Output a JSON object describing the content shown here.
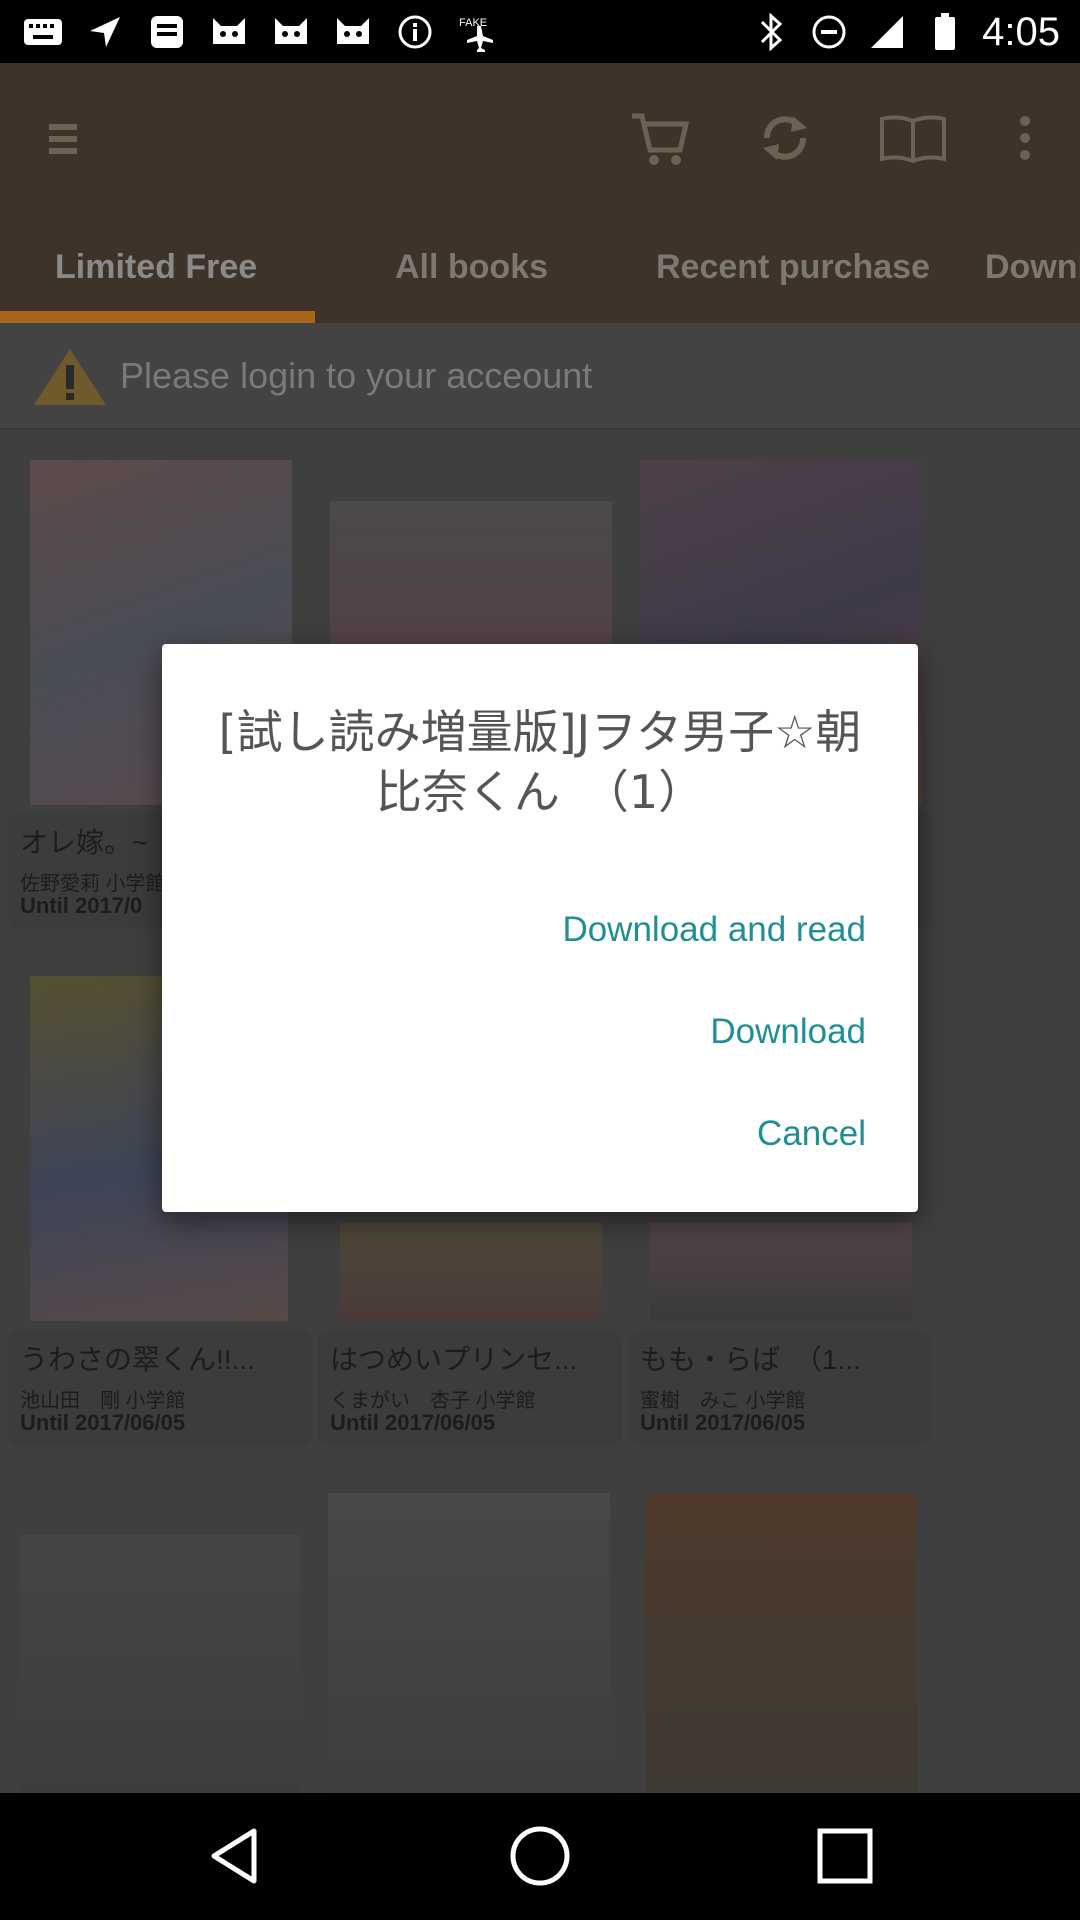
{
  "status_bar": {
    "time": "4:05",
    "icons": [
      "keyboard-icon",
      "navigation-icon",
      "app-icon",
      "cat-icon",
      "cat-icon",
      "cat-icon",
      "info-icon",
      "airplane-mode-icon",
      "bluetooth-icon",
      "silent-icon",
      "signal-icon",
      "battery-icon"
    ]
  },
  "app_bar": {
    "icons": [
      "menu-icon",
      "cart-icon",
      "refresh-icon",
      "book-icon",
      "more-icon"
    ]
  },
  "tabs": [
    "Limited Free",
    "All books",
    "Recent purchase",
    "Downl"
  ],
  "active_tab": "Limited Free",
  "login_banner": {
    "text": "Please login to your acceount"
  },
  "books": [
    {
      "title": "オレ嫁。~",
      "author": "佐野愛莉 小学館",
      "until": "Until 2017/0"
    },
    {
      "title": "",
      "author": "",
      "until": ""
    },
    {
      "title": "",
      "author": "",
      "until": ""
    },
    {
      "title": "うわさの翠くん!!...",
      "author": "池山田　剛 小学館",
      "until": "Until 2017/06/05"
    },
    {
      "title": "はつめいプリンセ...",
      "author": "くまがい　杏子 小学館",
      "until": "Until 2017/06/05"
    },
    {
      "title": "もも・らば　（1...",
      "author": "蜜樹　みこ 小学館",
      "until": "Until 2017/06/05"
    }
  ],
  "dialog": {
    "title": "[試し読み増量版]Jヲタ男子☆朝比奈くん　（1）",
    "buttons": {
      "download_and_read": "Download and read",
      "download": "Download",
      "cancel": "Cancel"
    }
  },
  "nav_bar": {
    "icons": [
      "back-icon",
      "home-icon",
      "recents-icon"
    ]
  },
  "colors": {
    "accent": "#1f8f93",
    "tab_indicator": "#a8661a",
    "app_bar": "#3d3328"
  }
}
